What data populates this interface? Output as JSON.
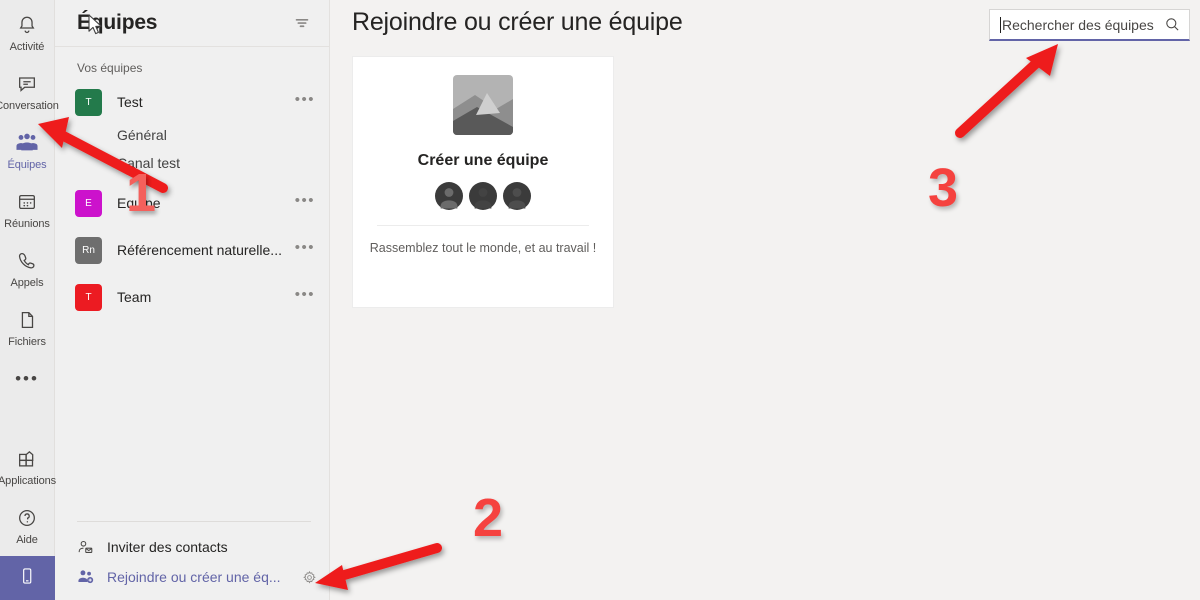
{
  "rail": {
    "items": [
      {
        "label": "Activité",
        "icon": "bell-icon",
        "name": "activity",
        "active": false
      },
      {
        "label": "Conversation",
        "icon": "chat-icon",
        "name": "conversation",
        "active": false
      },
      {
        "label": "Équipes",
        "icon": "teams-icon",
        "name": "teams",
        "active": true
      },
      {
        "label": "Réunions",
        "icon": "calendar-icon",
        "name": "meetings",
        "active": false
      },
      {
        "label": "Appels",
        "icon": "phone-icon",
        "name": "calls",
        "active": false
      },
      {
        "label": "Fichiers",
        "icon": "file-icon",
        "name": "files",
        "active": false
      }
    ],
    "more_label": "•••",
    "bottom_items": [
      {
        "label": "Applications",
        "icon": "apps-icon",
        "name": "apps"
      },
      {
        "label": "Aide",
        "icon": "help-icon",
        "name": "help"
      }
    ],
    "download_icon": "mobile-phone-icon",
    "accent_color": "#6264a7"
  },
  "panel": {
    "title": "Équipes",
    "filter_icon": "filter-icon",
    "group_label": "Vos équipes",
    "teams": [
      {
        "name": "Test",
        "initials": "T",
        "color": "#237a4b",
        "menu": "•••",
        "channels": [
          "Général",
          "Canal test"
        ]
      },
      {
        "name": "Equipe",
        "initials": "E",
        "color": "#cc12cc",
        "menu": "•••",
        "channels": []
      },
      {
        "name": "Référencement naturelle...",
        "initials": "Rn",
        "color": "#6e6e6e",
        "menu": "•••",
        "channels": []
      },
      {
        "name": "Team",
        "initials": "T",
        "color": "#ec1b22",
        "menu": "•••",
        "channels": []
      }
    ],
    "footer": {
      "invite": {
        "label": "Inviter des contacts",
        "icon": "person-mail-icon"
      },
      "join": {
        "label": "Rejoindre ou créer une éq...",
        "icon": "people-add-icon"
      },
      "gear_icon": "gear-icon"
    }
  },
  "main": {
    "title": "Rejoindre ou créer une équipe",
    "search": {
      "placeholder": "Rechercher des équipes",
      "value": "",
      "icon": "search-icon"
    },
    "card": {
      "image_icon": "image-placeholder-icon",
      "title": "Créer une équipe",
      "avatars_icon": "people-avatars-icon",
      "subtitle": "Rassemblez tout le monde, et au travail !"
    }
  },
  "annotations": {
    "markers": [
      {
        "id": "num1",
        "label": "1",
        "color": "#f4605c"
      },
      {
        "id": "num2",
        "label": "2",
        "color": "#f5423f"
      },
      {
        "id": "num3",
        "label": "3",
        "color": "#f5423f"
      }
    ],
    "arrow_color": "#ee1c1c"
  }
}
